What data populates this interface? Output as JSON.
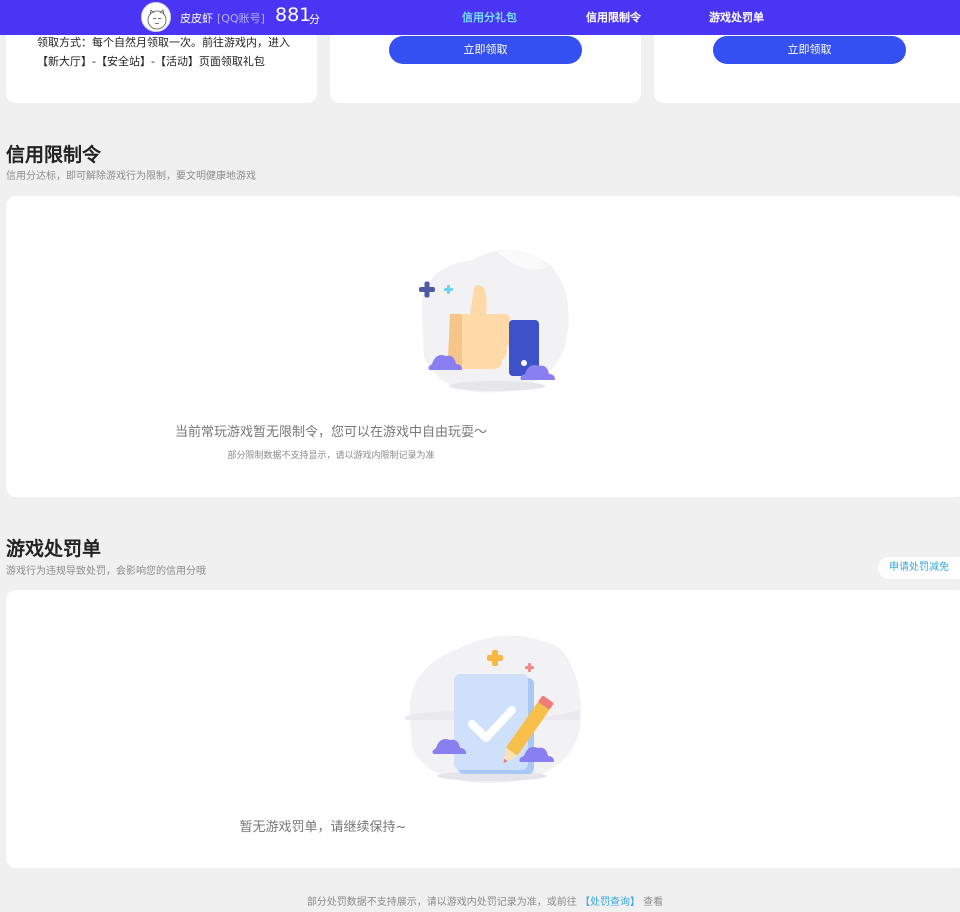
{
  "header": {
    "user_name": "皮皮虾",
    "account_type": "[QQ账号]",
    "score": "881",
    "score_unit": "分",
    "tabs": [
      {
        "label": "信用分礼包",
        "active": true
      },
      {
        "label": "信用限制令",
        "active": false
      },
      {
        "label": "游戏处罚单",
        "active": false
      }
    ]
  },
  "gifts": {
    "desc": "领取方式：每个自然月领取一次。前往游戏内，进入【新大厅】-【安全站】-【活动】页面领取礼包",
    "claim_label_1": "立即领取",
    "claim_label_2": "立即领取"
  },
  "restriction": {
    "title": "信用限制令",
    "subtitle": "信用分达标，即可解除游戏行为限制，要文明健康地游戏",
    "empty_text": "当前常玩游戏暂无限制令，您可以在游戏中自由玩耍～",
    "empty_note": "部分限制数据不支持显示，请以游戏内限制记录为准"
  },
  "penalty": {
    "title": "游戏处罚单",
    "subtitle": "游戏行为违规导致处罚，会影响您的信用分哦",
    "appeal_label": "申请处罚减免",
    "empty_text": "暂无游戏罚单，请继续保持~"
  },
  "footer": {
    "note_prefix": "部分处罚数据不支持展示，请以游戏内处罚记录为准，或前往",
    "link": "【处罚查询】",
    "note_suffix": "查看"
  },
  "colors": {
    "header_bg": "#4a35f5",
    "active_tab": "#79dcff",
    "button_blue": "#3450f0",
    "link_blue": "#36a6e0",
    "page_bg": "#f0f0f0"
  }
}
